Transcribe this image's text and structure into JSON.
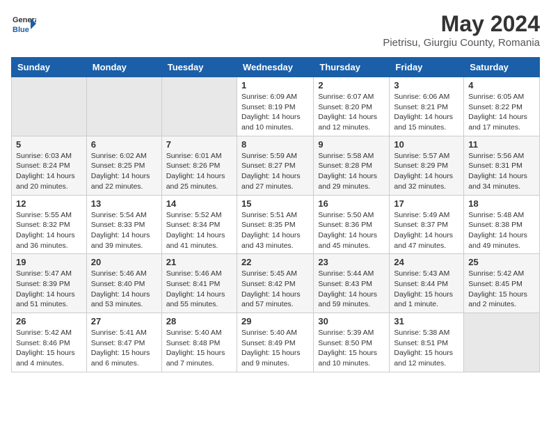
{
  "header": {
    "logo": {
      "general": "General",
      "blue": "Blue"
    },
    "title": "May 2024",
    "location": "Pietrisu, Giurgiu County, Romania"
  },
  "weekdays": [
    "Sunday",
    "Monday",
    "Tuesday",
    "Wednesday",
    "Thursday",
    "Friday",
    "Saturday"
  ],
  "weeks": [
    [
      {
        "day": "",
        "empty": true
      },
      {
        "day": "",
        "empty": true
      },
      {
        "day": "",
        "empty": true
      },
      {
        "day": "1",
        "sunrise": "6:09 AM",
        "sunset": "8:19 PM",
        "daylight": "14 hours and 10 minutes."
      },
      {
        "day": "2",
        "sunrise": "6:07 AM",
        "sunset": "8:20 PM",
        "daylight": "14 hours and 12 minutes."
      },
      {
        "day": "3",
        "sunrise": "6:06 AM",
        "sunset": "8:21 PM",
        "daylight": "14 hours and 15 minutes."
      },
      {
        "day": "4",
        "sunrise": "6:05 AM",
        "sunset": "8:22 PM",
        "daylight": "14 hours and 17 minutes."
      }
    ],
    [
      {
        "day": "5",
        "sunrise": "6:03 AM",
        "sunset": "8:24 PM",
        "daylight": "14 hours and 20 minutes."
      },
      {
        "day": "6",
        "sunrise": "6:02 AM",
        "sunset": "8:25 PM",
        "daylight": "14 hours and 22 minutes."
      },
      {
        "day": "7",
        "sunrise": "6:01 AM",
        "sunset": "8:26 PM",
        "daylight": "14 hours and 25 minutes."
      },
      {
        "day": "8",
        "sunrise": "5:59 AM",
        "sunset": "8:27 PM",
        "daylight": "14 hours and 27 minutes."
      },
      {
        "day": "9",
        "sunrise": "5:58 AM",
        "sunset": "8:28 PM",
        "daylight": "14 hours and 29 minutes."
      },
      {
        "day": "10",
        "sunrise": "5:57 AM",
        "sunset": "8:29 PM",
        "daylight": "14 hours and 32 minutes."
      },
      {
        "day": "11",
        "sunrise": "5:56 AM",
        "sunset": "8:31 PM",
        "daylight": "14 hours and 34 minutes."
      }
    ],
    [
      {
        "day": "12",
        "sunrise": "5:55 AM",
        "sunset": "8:32 PM",
        "daylight": "14 hours and 36 minutes."
      },
      {
        "day": "13",
        "sunrise": "5:54 AM",
        "sunset": "8:33 PM",
        "daylight": "14 hours and 39 minutes."
      },
      {
        "day": "14",
        "sunrise": "5:52 AM",
        "sunset": "8:34 PM",
        "daylight": "14 hours and 41 minutes."
      },
      {
        "day": "15",
        "sunrise": "5:51 AM",
        "sunset": "8:35 PM",
        "daylight": "14 hours and 43 minutes."
      },
      {
        "day": "16",
        "sunrise": "5:50 AM",
        "sunset": "8:36 PM",
        "daylight": "14 hours and 45 minutes."
      },
      {
        "day": "17",
        "sunrise": "5:49 AM",
        "sunset": "8:37 PM",
        "daylight": "14 hours and 47 minutes."
      },
      {
        "day": "18",
        "sunrise": "5:48 AM",
        "sunset": "8:38 PM",
        "daylight": "14 hours and 49 minutes."
      }
    ],
    [
      {
        "day": "19",
        "sunrise": "5:47 AM",
        "sunset": "8:39 PM",
        "daylight": "14 hours and 51 minutes."
      },
      {
        "day": "20",
        "sunrise": "5:46 AM",
        "sunset": "8:40 PM",
        "daylight": "14 hours and 53 minutes."
      },
      {
        "day": "21",
        "sunrise": "5:46 AM",
        "sunset": "8:41 PM",
        "daylight": "14 hours and 55 minutes."
      },
      {
        "day": "22",
        "sunrise": "5:45 AM",
        "sunset": "8:42 PM",
        "daylight": "14 hours and 57 minutes."
      },
      {
        "day": "23",
        "sunrise": "5:44 AM",
        "sunset": "8:43 PM",
        "daylight": "14 hours and 59 minutes."
      },
      {
        "day": "24",
        "sunrise": "5:43 AM",
        "sunset": "8:44 PM",
        "daylight": "15 hours and 1 minute."
      },
      {
        "day": "25",
        "sunrise": "5:42 AM",
        "sunset": "8:45 PM",
        "daylight": "15 hours and 2 minutes."
      }
    ],
    [
      {
        "day": "26",
        "sunrise": "5:42 AM",
        "sunset": "8:46 PM",
        "daylight": "15 hours and 4 minutes."
      },
      {
        "day": "27",
        "sunrise": "5:41 AM",
        "sunset": "8:47 PM",
        "daylight": "15 hours and 6 minutes."
      },
      {
        "day": "28",
        "sunrise": "5:40 AM",
        "sunset": "8:48 PM",
        "daylight": "15 hours and 7 minutes."
      },
      {
        "day": "29",
        "sunrise": "5:40 AM",
        "sunset": "8:49 PM",
        "daylight": "15 hours and 9 minutes."
      },
      {
        "day": "30",
        "sunrise": "5:39 AM",
        "sunset": "8:50 PM",
        "daylight": "15 hours and 10 minutes."
      },
      {
        "day": "31",
        "sunrise": "5:38 AM",
        "sunset": "8:51 PM",
        "daylight": "15 hours and 12 minutes."
      },
      {
        "day": "",
        "empty": true
      }
    ]
  ],
  "labels": {
    "sunrise": "Sunrise:",
    "sunset": "Sunset:",
    "daylight": "Daylight:"
  }
}
